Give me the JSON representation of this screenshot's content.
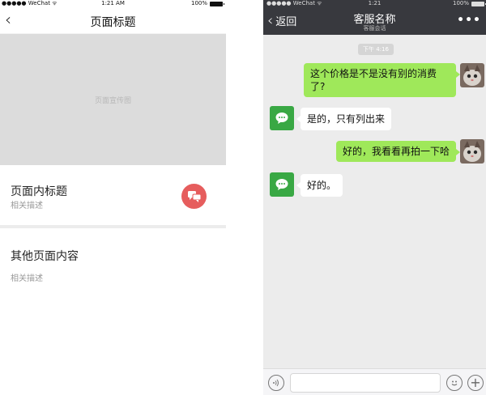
{
  "left": {
    "status": {
      "carrier": "●●●●● WeChat ᯤ",
      "time": "1:21 AM",
      "battery": "100%"
    },
    "nav": {
      "back_icon": "‹",
      "title": "页面标题"
    },
    "banner": {
      "label": "页面宣传图"
    },
    "section1": {
      "title": "页面内标题",
      "desc": "相关描述",
      "fab_icon": "chat-bubbles-icon",
      "fab_color": "#e65d5d"
    },
    "section2": {
      "title": "其他页面内容",
      "desc": "相关描述"
    }
  },
  "right": {
    "status": {
      "carrier": "●●●●● WeChat ᯤ",
      "time": "1:21",
      "battery": "100%"
    },
    "nav": {
      "back_label": "返回",
      "title": "客服名称",
      "subtitle": "客服会话",
      "more": "•••"
    },
    "timestamp": "下午 4:16",
    "messages": [
      {
        "from": "me",
        "text": "这个价格是不是没有别的消费了?"
      },
      {
        "from": "service",
        "text": "是的，只有列出来"
      },
      {
        "from": "me",
        "text": "好的，我看看再拍一下哈"
      },
      {
        "from": "service",
        "text": "好的。"
      }
    ],
    "colors": {
      "me_bubble": "#9fe85a",
      "service_avatar": "#39a844",
      "nav_bg": "#38393e"
    }
  }
}
